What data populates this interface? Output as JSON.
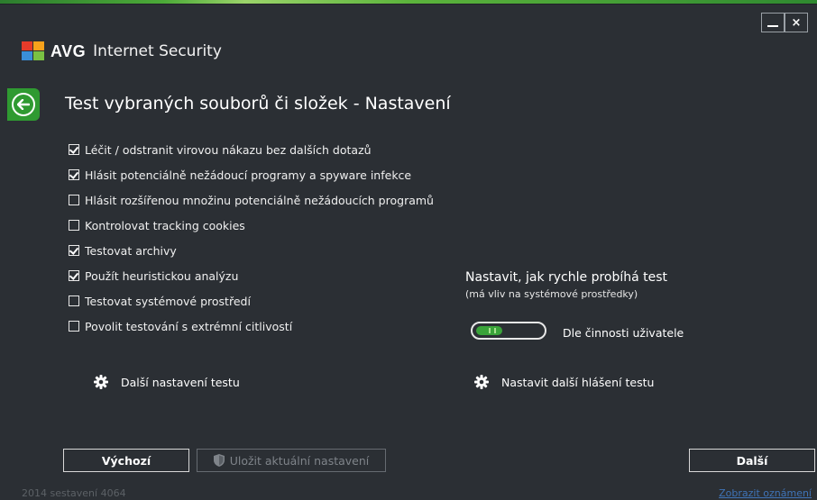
{
  "app": {
    "brand": "AVG",
    "product": "Internet Security"
  },
  "window_controls": {
    "minimize": "_",
    "close": "×"
  },
  "page": {
    "title": "Test vybraných souborů či složek - Nastavení"
  },
  "options": [
    {
      "label": "Léčit / odstranit virovou nákazu bez dalších dotazů",
      "checked": true
    },
    {
      "label": "Hlásit potenciálně nežádoucí programy a spyware infekce",
      "checked": true
    },
    {
      "label": "Hlásit rozšířenou množinu potenciálně nežádoucích programů",
      "checked": false
    },
    {
      "label": "Kontrolovat tracking cookies",
      "checked": false
    },
    {
      "label": "Testovat archivy",
      "checked": true
    },
    {
      "label": "Použít heuristickou analýzu",
      "checked": true
    },
    {
      "label": "Testovat systémové prostředí",
      "checked": false
    },
    {
      "label": "Povolit testování s extrémní citlivostí",
      "checked": false
    }
  ],
  "speed": {
    "title": "Nastavit, jak rychle probíhá test",
    "note": "(má vliv na systémové prostředky)",
    "value_label": "Dle činnosti uživatele",
    "level_fraction": 0.4
  },
  "links": {
    "more_settings": "Další nastavení testu",
    "more_reports": "Nastavit další hlášení testu"
  },
  "buttons": {
    "default": "Výchozí",
    "save": "Uložit aktuální nastavení",
    "next": "Další"
  },
  "footer": {
    "build": "2014  sestavení 4064",
    "notifications": "Zobrazit oznámení"
  },
  "colors": {
    "accent_green": "#2f9a31",
    "background": "#2b2f34",
    "link_blue": "#3f74b8"
  },
  "icons": {
    "back": "arrow-left-icon",
    "gear": "gear-icon",
    "shield": "shield-icon",
    "logo": "avg-logo"
  }
}
